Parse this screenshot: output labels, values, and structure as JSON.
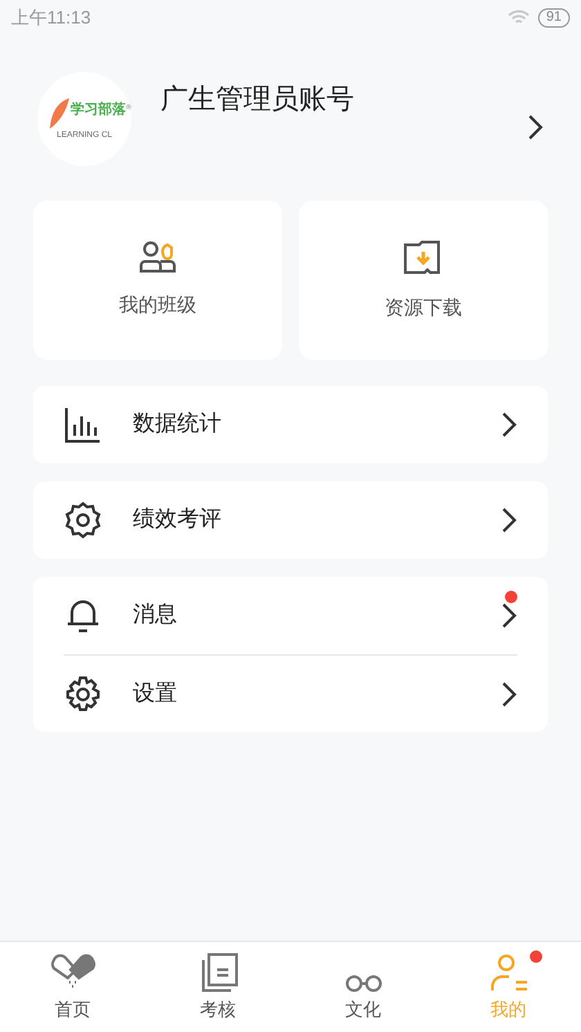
{
  "status_bar": {
    "time": "上午11:13",
    "battery": "91"
  },
  "profile": {
    "logo_title": "学习部落",
    "logo_mark": "®",
    "logo_subtitle": "LEARNING CL",
    "name": "广生管理员账号"
  },
  "shortcuts": [
    {
      "kind": "class",
      "label": "我的班级"
    },
    {
      "kind": "download",
      "label": "资源下载"
    }
  ],
  "menu_groups": [
    [
      {
        "kind": "stats",
        "label": "数据统计",
        "badge": false
      }
    ],
    [
      {
        "kind": "review",
        "label": "绩效考评",
        "badge": false
      }
    ],
    [
      {
        "kind": "bell",
        "label": "消息",
        "badge": true
      },
      {
        "kind": "gear",
        "label": "设置",
        "badge": false
      }
    ]
  ],
  "tabs": [
    {
      "kind": "home",
      "label": "首页",
      "selected": false,
      "badge": false
    },
    {
      "kind": "exam",
      "label": "考核",
      "selected": false,
      "badge": false
    },
    {
      "kind": "culture",
      "label": "文化",
      "selected": false,
      "badge": false
    },
    {
      "kind": "me",
      "label": "我的",
      "selected": true,
      "badge": true
    }
  ]
}
